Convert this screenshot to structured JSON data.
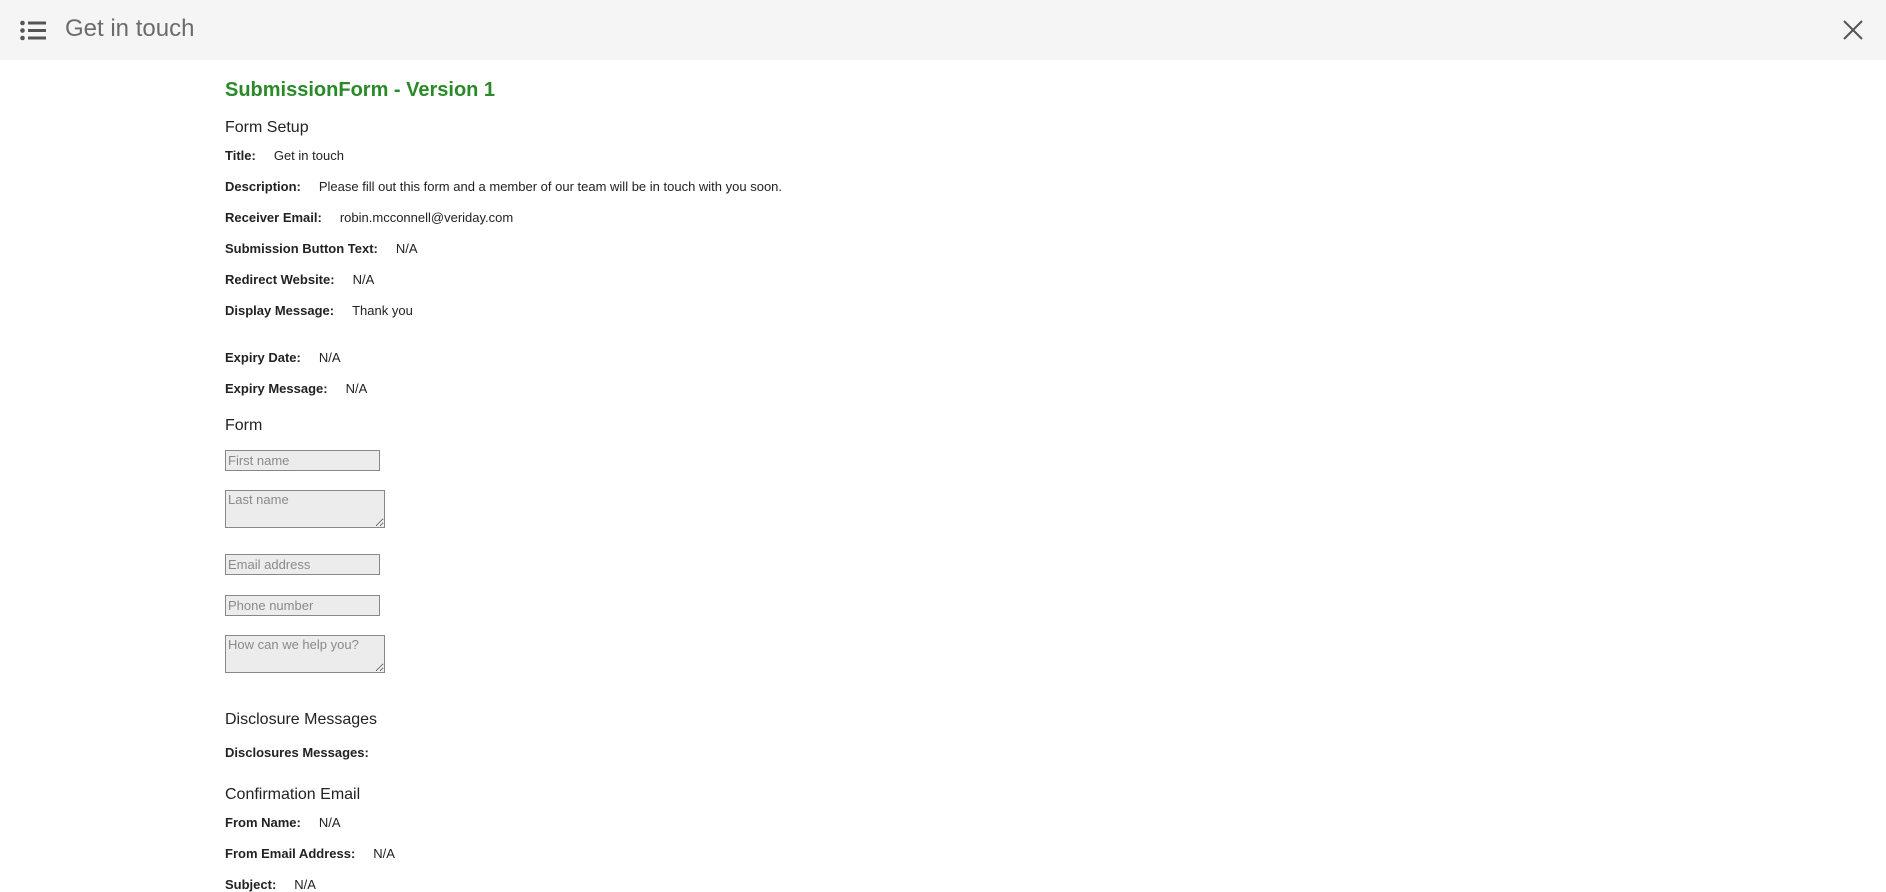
{
  "header": {
    "title": "Get in touch",
    "menu_icon": "list-icon",
    "close_icon": "close-icon"
  },
  "page": {
    "title": "SubmissionForm - Version 1"
  },
  "form_setup": {
    "heading": "Form Setup",
    "rows": [
      {
        "label": "Title:",
        "value": "Get in touch"
      },
      {
        "label": "Description:",
        "value": "Please fill out this form and a member of our team will be in touch with you soon."
      },
      {
        "label": "Receiver Email:",
        "value": "robin.mcconnell@veriday.com"
      },
      {
        "label": "Submission Button Text:",
        "value": "N/A"
      },
      {
        "label": "Redirect Website:",
        "value": "N/A"
      },
      {
        "label": "Display Message:",
        "value": "Thank you"
      },
      {
        "label": "Expiry Date:",
        "value": "N/A"
      },
      {
        "label": "Expiry Message:",
        "value": "N/A"
      }
    ]
  },
  "form": {
    "heading": "Form",
    "fields": [
      {
        "placeholder": "First name",
        "type": "input"
      },
      {
        "placeholder": "Last name",
        "type": "textarea"
      },
      {
        "placeholder": "Email address",
        "type": "input"
      },
      {
        "placeholder": "Phone number",
        "type": "input"
      },
      {
        "placeholder": "How can we help you?",
        "type": "textarea"
      }
    ]
  },
  "disclosure": {
    "heading": "Disclosure Messages",
    "label": "Disclosures Messages:"
  },
  "confirmation": {
    "heading": "Confirmation Email",
    "rows": [
      {
        "label": "From Name:",
        "value": "N/A"
      },
      {
        "label": "From Email Address:",
        "value": "N/A"
      },
      {
        "label": "Subject:",
        "value": "N/A"
      }
    ]
  },
  "colors": {
    "accent": "#2a8a2a",
    "header_bg": "#f5f5f5"
  }
}
